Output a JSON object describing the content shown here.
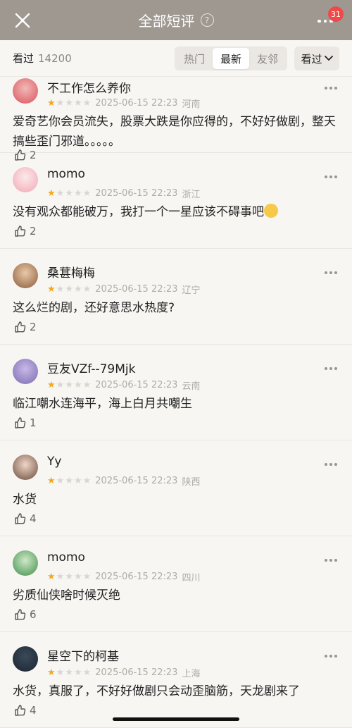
{
  "header": {
    "title": "全部短评",
    "badge": "31",
    "help_glyph": "?"
  },
  "filter": {
    "seen_label": "看过",
    "seen_count": "14200",
    "tabs": [
      "热门",
      "最新",
      "友邻"
    ],
    "active_tab": "最新",
    "seen_filter": "看过"
  },
  "comments": [
    {
      "name": "不工作怎么养你",
      "rating": 1,
      "date": "2025-06-15 22:23",
      "region": "河南",
      "text": "爱奇艺你会员流失，股票大跌是你应得的，不好好做剧，整天搞些歪门邪道。。。。。",
      "likes": "2"
    },
    {
      "name": "momo",
      "rating": 1,
      "date": "2025-06-15 22:23",
      "region": "浙江",
      "text": "没有观众都能破万，我打一个一星应该不碍事吧",
      "likes": "2"
    },
    {
      "name": "桑葚梅梅",
      "rating": 1,
      "date": "2025-06-15 22:23",
      "region": "辽宁",
      "text": "这么烂的剧，还好意思水热度?",
      "likes": "2"
    },
    {
      "name": "豆友VZf--79Mjk",
      "rating": 1,
      "date": "2025-06-15 22:23",
      "region": "云南",
      "text": "临江嘲水连海平，海上白月共嘲生",
      "likes": "1"
    },
    {
      "name": "Yy",
      "rating": 1,
      "date": "2025-06-15 22:23",
      "region": "陕西",
      "text": "水货",
      "likes": "4"
    },
    {
      "name": "momo",
      "rating": 1,
      "date": "2025-06-15 22:23",
      "region": "四川",
      "text": "劣质仙侠啥时候灭绝",
      "likes": "6"
    },
    {
      "name": "星空下的柯基",
      "rating": 1,
      "date": "2025-06-15 22:23",
      "region": "上海",
      "text": "水货，真服了，不好好做剧只会动歪脑筋，天龙剧来了",
      "likes": "4"
    }
  ],
  "icons": {
    "close": "close-icon",
    "help": "help-icon",
    "more": "more-icon",
    "chevron": "chevron-down-icon",
    "star": "star-icon",
    "like": "thumbs-up-icon"
  },
  "colors": {
    "header_bg": "#9e9891",
    "page_bg": "#f7f6f3",
    "star_on": "#f4a71d",
    "star_off": "#d9d6d1",
    "badge": "#ef4a4a"
  }
}
